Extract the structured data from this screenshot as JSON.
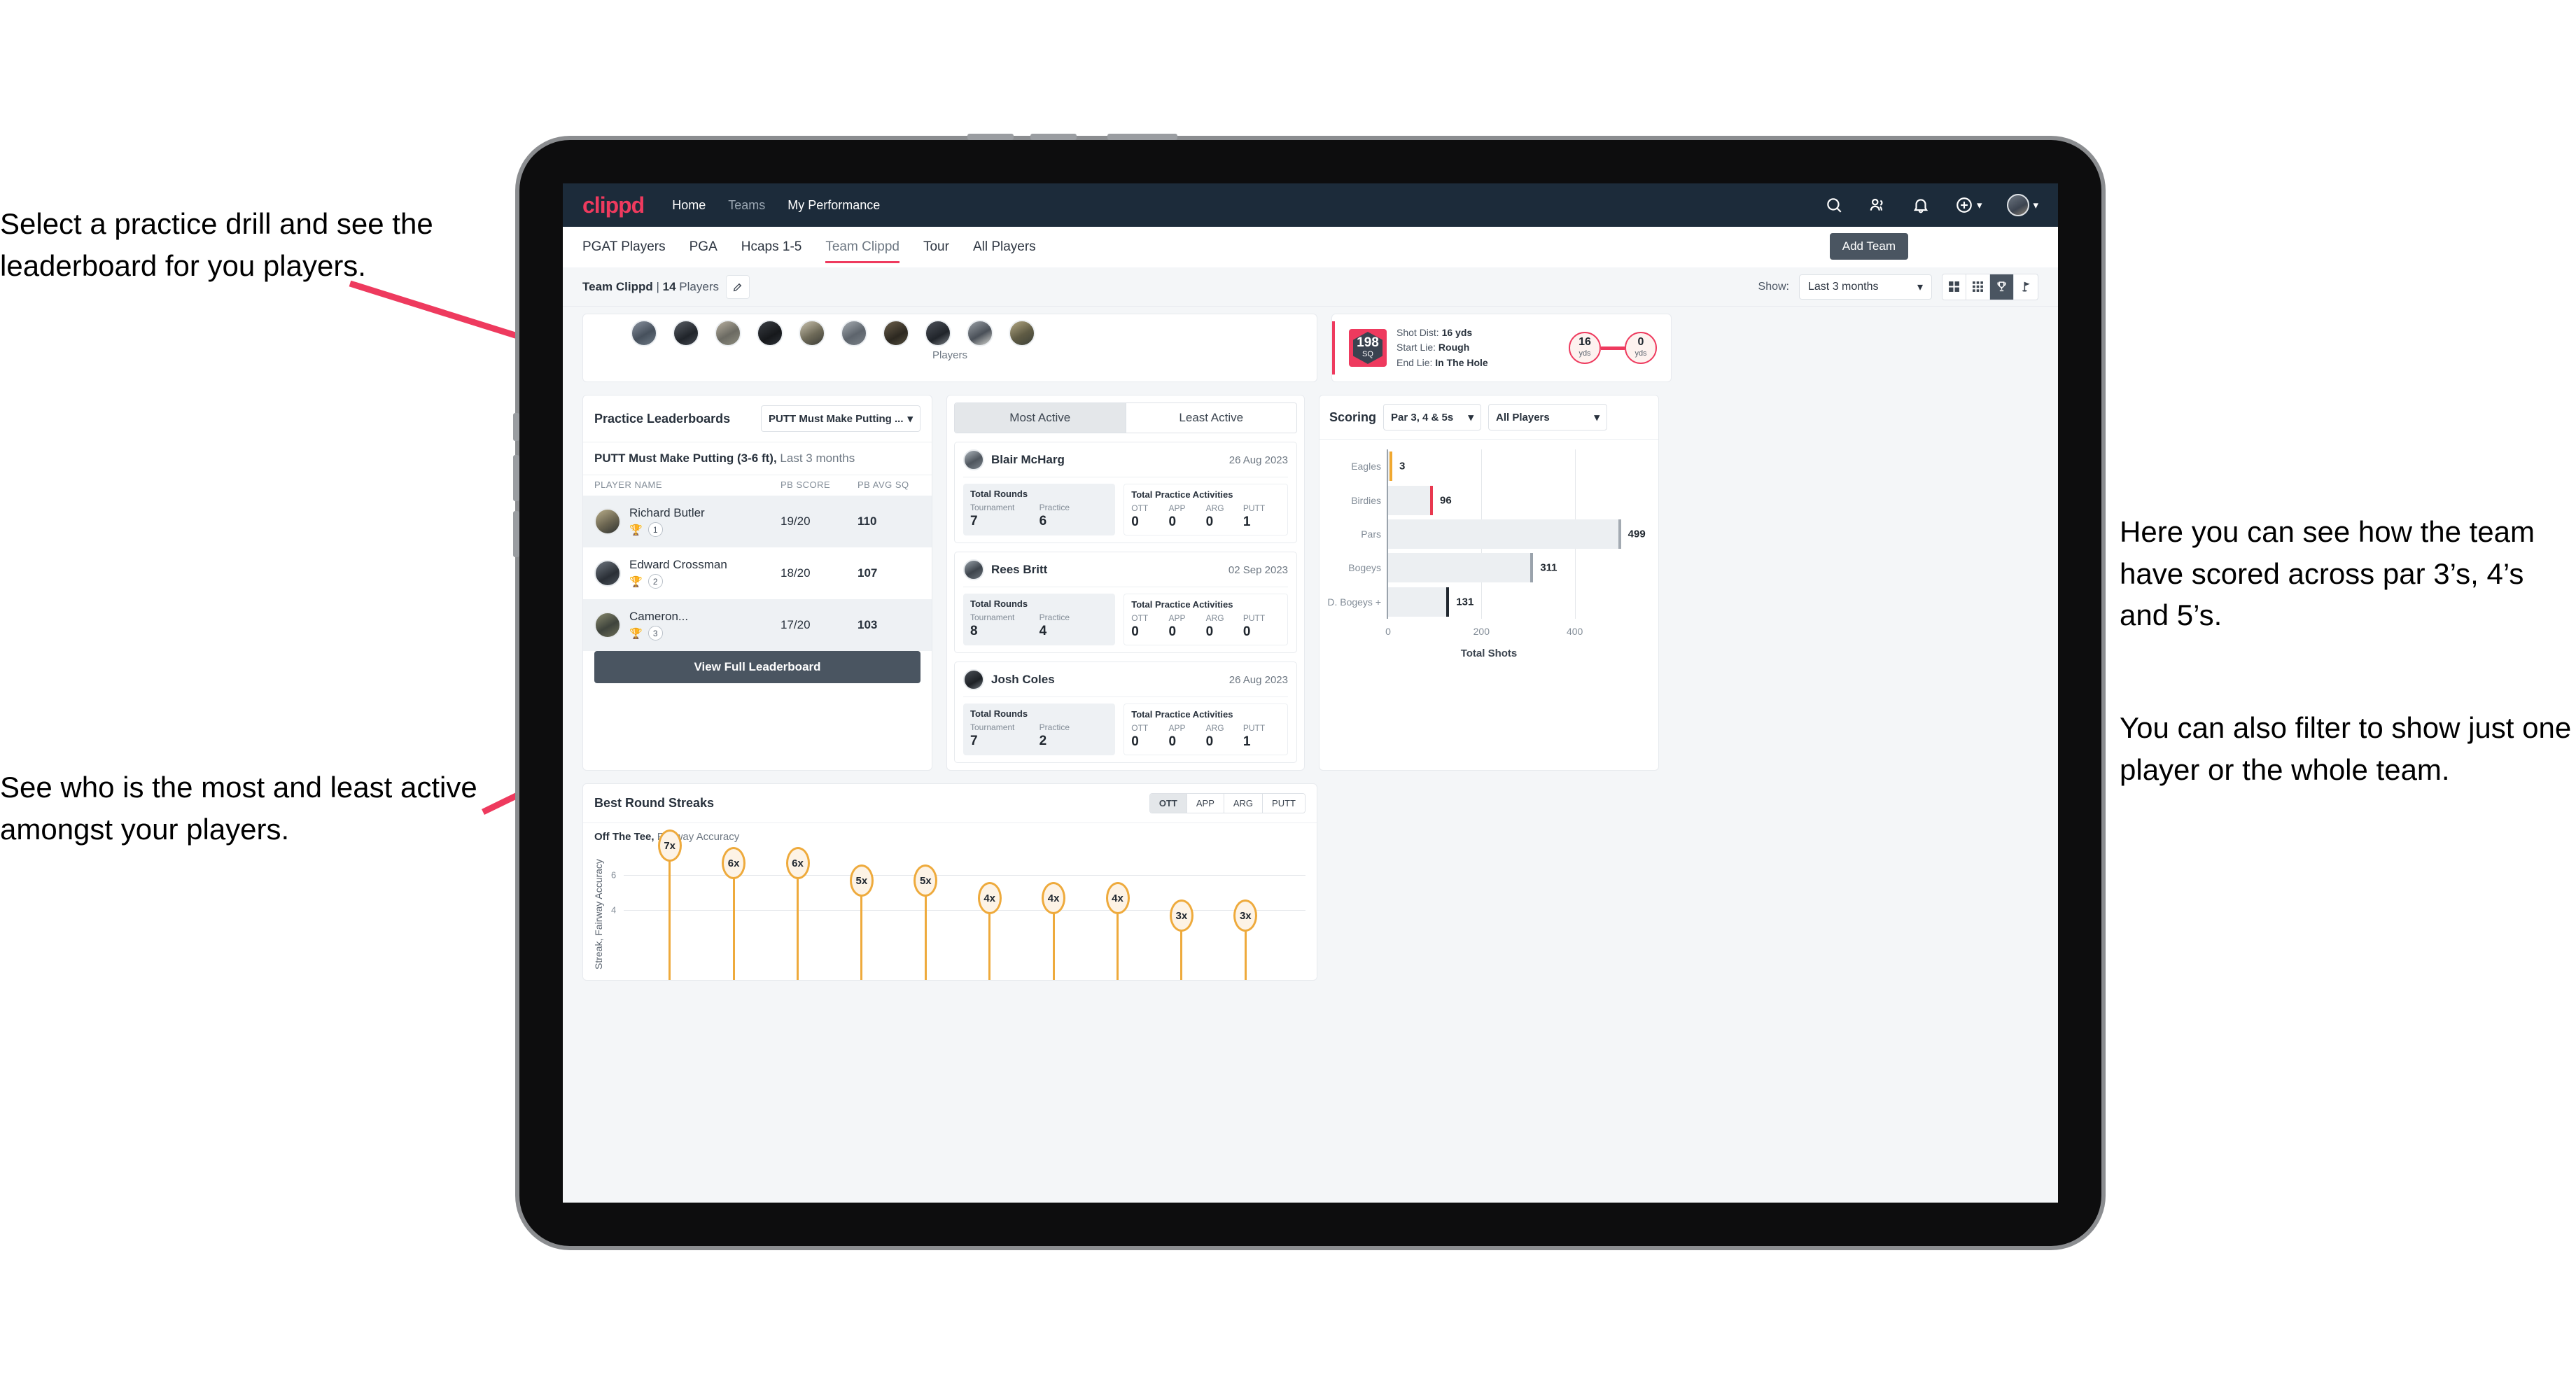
{
  "annotations": {
    "top_left": "Select a practice drill and see the leaderboard for you players.",
    "mid_left": "See who is the most and least active amongst your players.",
    "right_1": "Here you can see how the team have scored across par 3’s, 4’s and 5’s.",
    "right_2": "You can also filter to show just one player or the whole team.",
    "accent_color": "#ee3a5e"
  },
  "navbar": {
    "logo": "clippd",
    "links": [
      {
        "label": "Home",
        "active": true
      },
      {
        "label": "Teams",
        "active": false
      },
      {
        "label": "My Performance",
        "active": true
      }
    ],
    "icons": [
      "search-icon",
      "people-icon",
      "bell-icon",
      "plus-circle-icon",
      "avatar"
    ]
  },
  "tabs": [
    {
      "label": "PGAT Players",
      "active": false
    },
    {
      "label": "PGA",
      "active": false
    },
    {
      "label": "Hcaps 1-5",
      "active": false
    },
    {
      "label": "Team Clippd",
      "active": true
    },
    {
      "label": "Tour",
      "active": false
    },
    {
      "label": "All Players",
      "active": false
    }
  ],
  "add_team_button": "Add Team",
  "subheader": {
    "team_name": "Team Clippd",
    "separator": "|",
    "player_count": "14",
    "players_word": "Players",
    "edit_icon": "pencil-icon",
    "show_label": "Show:",
    "show_value": "Last 3 months",
    "view_modes": [
      "grid-large-icon",
      "grid-small-icon",
      "trophy-icon",
      "flag-icon"
    ],
    "active_view": "trophy-icon"
  },
  "players_card": {
    "caption": "Players",
    "avatar_count": 10
  },
  "shot_card": {
    "sq_value": "198",
    "sq_unit": "SQ",
    "lines": [
      {
        "label": "Shot Dist:",
        "value": "16 yds"
      },
      {
        "label": "Start Lie:",
        "value": "Rough"
      },
      {
        "label": "End Lie:",
        "value": "In The Hole"
      }
    ],
    "start_bubble": {
      "value": "16",
      "unit": "yds"
    },
    "end_bubble": {
      "value": "0",
      "unit": "yds"
    }
  },
  "leaderboard": {
    "title": "Practice Leaderboards",
    "drill_select": "PUTT Must Make Putting ...",
    "subtitle_bold": "PUTT Must Make Putting (3-6 ft),",
    "subtitle_rest": "Last 3 months",
    "columns": [
      "PLAYER NAME",
      "PB SCORE",
      "PB AVG SQ"
    ],
    "rows": [
      {
        "name": "Richard Butler",
        "rank": "1",
        "trophy": "gold",
        "score": "19/20",
        "avg": "110"
      },
      {
        "name": "Edward Crossman",
        "rank": "2",
        "trophy": "silver",
        "score": "18/20",
        "avg": "107"
      },
      {
        "name": "Cameron...",
        "rank": "3",
        "trophy": "bronze",
        "score": "17/20",
        "avg": "103"
      }
    ],
    "button": "View Full Leaderboard"
  },
  "activity": {
    "tabs": [
      {
        "label": "Most Active",
        "active": true
      },
      {
        "label": "Least Active",
        "active": false
      }
    ],
    "rounds_header": "Total Rounds",
    "activities_header": "Total Practice Activities",
    "rounds_keys": [
      "Tournament",
      "Practice"
    ],
    "activity_keys": [
      "OTT",
      "APP",
      "ARG",
      "PUTT"
    ],
    "players": [
      {
        "name": "Blair McHarg",
        "date": "26 Aug 2023",
        "rounds": [
          "7",
          "6"
        ],
        "activities": [
          "0",
          "0",
          "0",
          "1"
        ]
      },
      {
        "name": "Rees Britt",
        "date": "02 Sep 2023",
        "rounds": [
          "8",
          "4"
        ],
        "activities": [
          "0",
          "0",
          "0",
          "0"
        ]
      },
      {
        "name": "Josh Coles",
        "date": "26 Aug 2023",
        "rounds": [
          "7",
          "2"
        ],
        "activities": [
          "0",
          "0",
          "0",
          "1"
        ]
      }
    ]
  },
  "scoring": {
    "title": "Scoring",
    "par_select": "Par 3, 4 & 5s",
    "players_select": "All Players"
  },
  "streaks": {
    "title": "Best Round Streaks",
    "toggle": [
      {
        "label": "OTT",
        "active": true
      },
      {
        "label": "APP",
        "active": false
      },
      {
        "label": "ARG",
        "active": false
      },
      {
        "label": "PUTT",
        "active": false
      }
    ],
    "sub_bold": "Off The Tee,",
    "sub_rest": "Fairway Accuracy"
  },
  "chart_data": [
    {
      "type": "bar",
      "orientation": "horizontal",
      "title": "Scoring",
      "categories": [
        "Eagles",
        "Birdies",
        "Pars",
        "Bogeys",
        "D. Bogeys +"
      ],
      "values": [
        3,
        96,
        499,
        311,
        131
      ],
      "bar_cap_colors": [
        "#f0a830",
        "#e8384f",
        "#a3aab2",
        "#9aa3ac",
        "#20272f"
      ],
      "xlabel": "Total Shots",
      "ylabel": "",
      "xlim": [
        0,
        540
      ],
      "xticks": [
        0,
        200,
        400
      ],
      "grid": true,
      "legend": "none"
    },
    {
      "type": "scatter",
      "title": "Best Round Streaks",
      "subtitle": "Off The Tee, Fairway Accuracy",
      "ylabel": "Streak, Fairway Accuracy",
      "xlabel": "",
      "ylim": [
        0,
        7.6
      ],
      "yticks": [
        4,
        6
      ],
      "labels": [
        "7x",
        "6x",
        "6x",
        "5x",
        "5x",
        "4x",
        "4x",
        "4x",
        "3x",
        "3x"
      ],
      "values": [
        7,
        6,
        6,
        5,
        5,
        4,
        4,
        4,
        3,
        3
      ],
      "marker_color": "#eeaa3c",
      "grid": true
    }
  ]
}
